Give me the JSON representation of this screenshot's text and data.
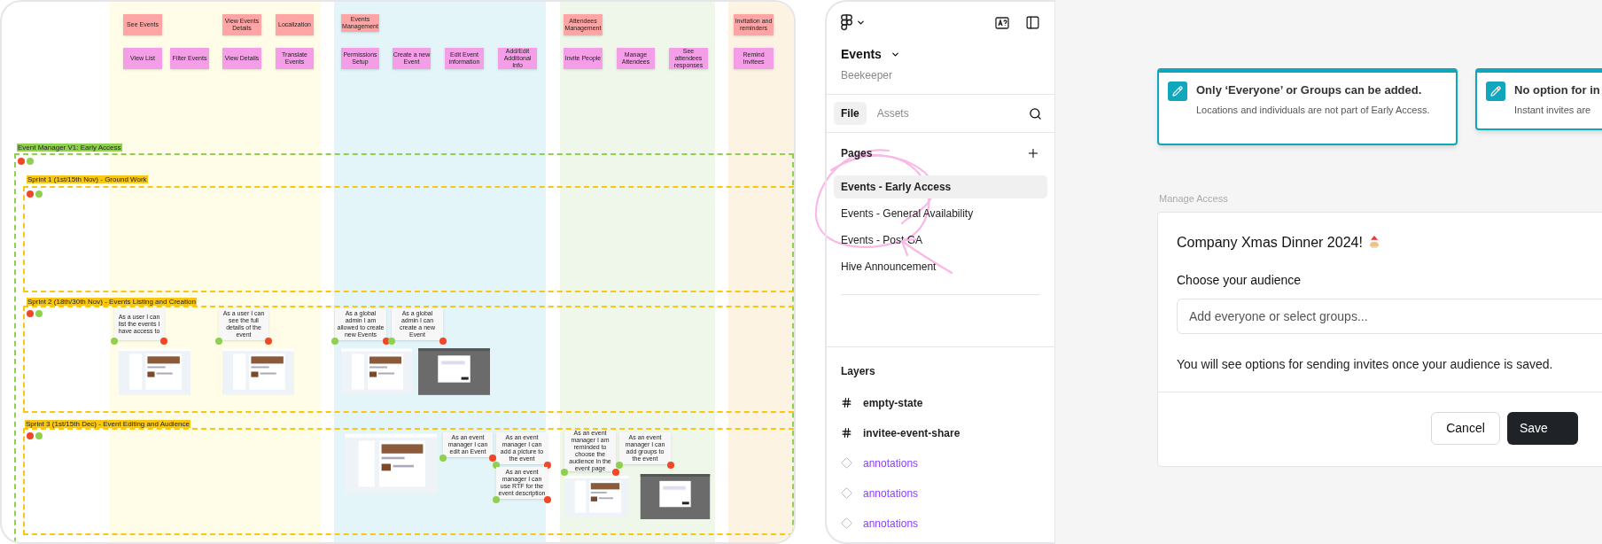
{
  "board": {
    "stickies": [
      {
        "text": "See Events",
        "kind": "category"
      },
      {
        "text": "View Events Details",
        "kind": "category"
      },
      {
        "text": "Localization",
        "kind": "category"
      },
      {
        "text": "Events Management",
        "kind": "category"
      },
      {
        "text": "Attendees Management",
        "kind": "category"
      },
      {
        "text": "Invitation and reminders",
        "kind": "category"
      },
      {
        "text": "View List",
        "kind": "feature"
      },
      {
        "text": "Filter Events",
        "kind": "feature"
      },
      {
        "text": "View Details",
        "kind": "feature"
      },
      {
        "text": "Translate Events",
        "kind": "feature"
      },
      {
        "text": "Permissions Setup",
        "kind": "feature"
      },
      {
        "text": "Create a new Event",
        "kind": "feature"
      },
      {
        "text": "Edit Event information",
        "kind": "feature"
      },
      {
        "text": "Add/Edit Additional Info",
        "kind": "feature"
      },
      {
        "text": "Invite People",
        "kind": "feature"
      },
      {
        "text": "Manage Attendees",
        "kind": "feature"
      },
      {
        "text": "See attendees responses",
        "kind": "feature"
      },
      {
        "text": "Remind Invitees",
        "kind": "feature"
      }
    ],
    "frames": [
      {
        "label": "Event Manager V1: Early Access",
        "kind": "release"
      },
      {
        "label": "Sprint 1 (1st/15th Nov) - Ground Work",
        "kind": "sprint"
      },
      {
        "label": "Sprint 2 (18th/30th Nov) - Events Listing and Creation",
        "kind": "sprint"
      },
      {
        "label": "Sprint 3 (1st/15th Dec) - Event Editing and Audience",
        "kind": "sprint"
      }
    ],
    "stories": [
      {
        "text": "As a user I can list the events I have access to"
      },
      {
        "text": "As a user I can see the full details of the event"
      },
      {
        "text": "As a global admin I am allowed to create new Events"
      },
      {
        "text": "As a global admin I can create a new Event"
      },
      {
        "text": "As an event manager I can edit an Event"
      },
      {
        "text": "As an event manager I can add a picture to the event"
      },
      {
        "text": "As an event manager I can use RTF for the event description"
      },
      {
        "text": "As an event manager I am reminded to choose the audience in the event page"
      },
      {
        "text": "As an event manager I can add groups to the event"
      }
    ]
  },
  "sidebar": {
    "file_name": "Events",
    "team": "Beekeeper",
    "tabs": [
      {
        "label": "File",
        "selected": true
      },
      {
        "label": "Assets",
        "selected": false
      }
    ],
    "pages_heading": "Pages",
    "pages": [
      {
        "label": "Events - Early Access",
        "selected": true
      },
      {
        "label": "Events - General Availability",
        "selected": false
      },
      {
        "label": "Events - Post GA",
        "selected": false
      },
      {
        "label": "Hive Announcement",
        "selected": false
      }
    ],
    "layers_heading": "Layers",
    "layers": [
      {
        "name": "empty-state",
        "kind": "frame"
      },
      {
        "name": "invitee-event-share",
        "kind": "frame"
      },
      {
        "name": "annotations",
        "kind": "component"
      },
      {
        "name": "annotations",
        "kind": "component"
      },
      {
        "name": "annotations",
        "kind": "component"
      }
    ]
  },
  "canvas": {
    "notes": [
      {
        "title": "Only ‘Everyone’ or Groups can be added.",
        "body": "Locations and individuals are not part of Early Access."
      },
      {
        "title": "No option for in",
        "body": "Instant invites are"
      }
    ],
    "section_label": "Manage Access",
    "dialog": {
      "title": "Company Xmas Dinner 2024!",
      "audience_label": "Choose your audience",
      "audience_placeholder": "Add everyone or select groups...",
      "helper": "You will see options for sending invites once your audience is saved.",
      "buttons": [
        {
          "label": "Cancel",
          "kind": "secondary"
        },
        {
          "label": "Save",
          "kind": "primary"
        }
      ]
    }
  }
}
